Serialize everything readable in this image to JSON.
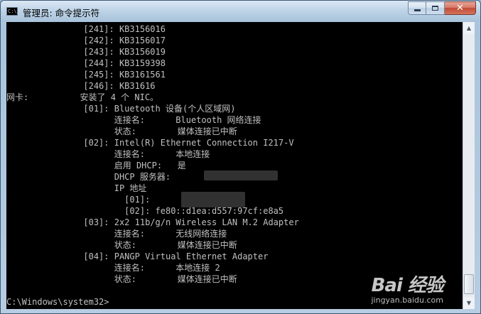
{
  "window": {
    "title": "管理员: 命令提示符",
    "icon": "cmd-icon",
    "buttons": {
      "minimize": "minimize-icon",
      "maximize": "maximize-icon",
      "close": "✕"
    }
  },
  "console": {
    "lines": [
      "               [241]: KB3156016",
      "               [242]: KB3156017",
      "               [243]: KB3156019",
      "               [244]: KB3159398",
      "               [245]: KB3161561",
      "               [246]: KB31616",
      "网卡:          安装了 4 个 NIC。",
      "               [01]: Bluetooth 设备(个人区域网)",
      "                     连接名:      Bluetooth 网络连接",
      "                     状态:        媒体连接已中断",
      "               [02]: Intel(R) Ethernet Connection I217-V",
      "                     连接名:      本地连接",
      "                     启用 DHCP:   是",
      "                     DHCP 服务器:",
      "                     IP 地址",
      "                       [01]:",
      "                       [02]: fe80::d1ea:d557:97cf:e8a5",
      "               [03]: 2x2 11b/g/n Wireless LAN M.2 Adapter",
      "                     连接名:      无线网络连接",
      "                     状态:        媒体连接已中断",
      "               [04]: PANGP Virtual Ethernet Adapter",
      "                     连接名:      本地连接 2",
      "                     状态:        媒体连接已中断",
      "",
      "C:\\Windows\\system32>"
    ]
  },
  "watermark": {
    "logo": "Bai 经验",
    "url": "jingyan.baidu.com"
  }
}
